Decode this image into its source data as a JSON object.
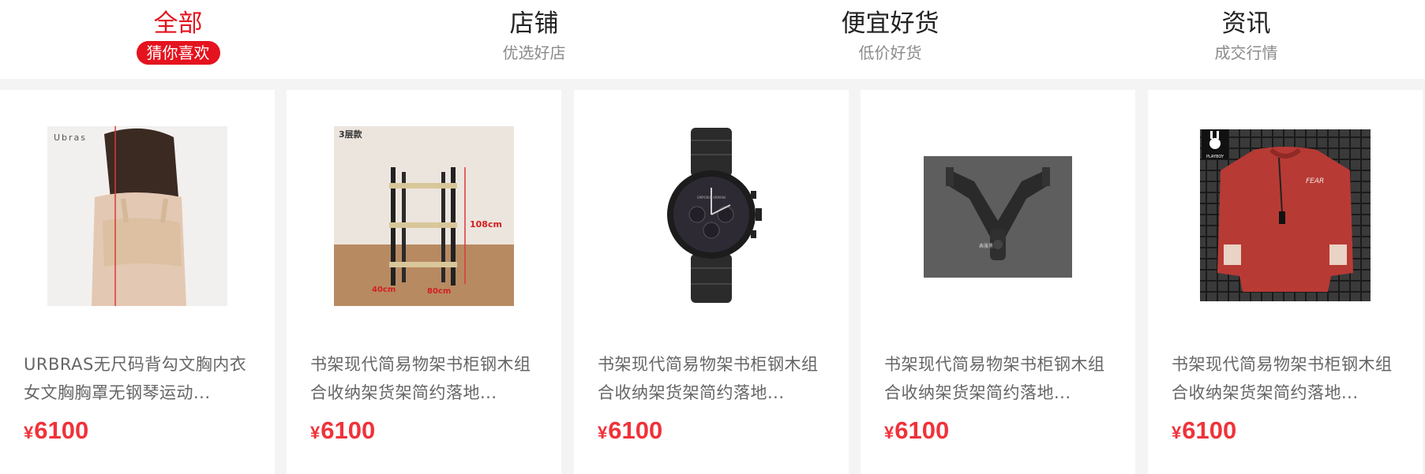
{
  "tabs": [
    {
      "title": "全部",
      "subtitle": "猜你喜欢",
      "active": true
    },
    {
      "title": "店铺",
      "subtitle": "优选好店",
      "active": false
    },
    {
      "title": "便宜好货",
      "subtitle": "低价好货",
      "active": false
    },
    {
      "title": "资讯",
      "subtitle": "成交行情",
      "active": false
    }
  ],
  "products": [
    {
      "name_line1": "URBRAS无尺码背勾文胸内衣",
      "name_line2": "女文胸胸罩无钢琴运动...",
      "currency": "¥",
      "price": "6100",
      "image_text": "Ubras"
    },
    {
      "name_line1": "书架现代简易物架书柜钢木组",
      "name_line2": "合收纳架货架简约落地...",
      "currency": "¥",
      "price": "6100",
      "image_text": "3层款",
      "image_dims": [
        "108cm",
        "40cm",
        "80cm"
      ]
    },
    {
      "name_line1": "书架现代简易物架书柜钢木组",
      "name_line2": "合收纳架货架简约落地...",
      "currency": "¥",
      "price": "6100",
      "image_text": "EMPORIO ARMANI"
    },
    {
      "name_line1": "书架现代简易物架书柜钢木组",
      "name_line2": "合收纳架货架简约落地...",
      "currency": "¥",
      "price": "6100",
      "image_text": "典雅黑"
    },
    {
      "name_line1": "书架现代简易物架书柜钢木组",
      "name_line2": "合收纳架货架简约落地...",
      "currency": "¥",
      "price": "6100",
      "image_text": "PLAYBOY"
    }
  ],
  "colors": {
    "accent": "#e4131e",
    "price": "#f0323a",
    "text_primary": "#222222",
    "text_secondary": "#8b8b8b",
    "background": "#f4f4f4"
  }
}
